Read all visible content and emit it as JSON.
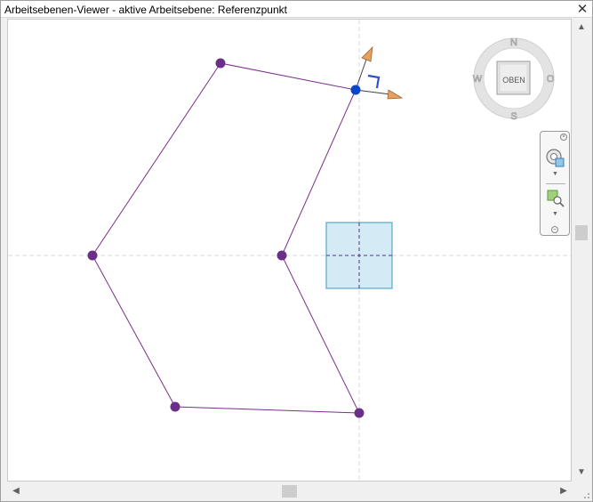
{
  "window": {
    "title": "Arbeitsebenen-Viewer - aktive Arbeitsebene: Referenzpunkt"
  },
  "viewcube": {
    "face_label": "OBEN",
    "compass": {
      "north": "N",
      "south": "S",
      "east": "O",
      "west": "W"
    }
  },
  "icons": {
    "close": "close-icon",
    "steering_wheel": "steering-wheel-icon",
    "zoom": "zoom-icon",
    "scroll_up": "chevron-up-icon",
    "scroll_down": "chevron-down-icon",
    "scroll_left": "chevron-left-icon",
    "scroll_right": "chevron-right-icon"
  },
  "colors": {
    "sketch_line": "#7a2f8a",
    "vertex": "#6b2f8a",
    "active_point": "#0a46c8",
    "ref_plane": "#d9d9d9",
    "plane_fill": "#d4ebf6",
    "plane_stroke": "#3a9ac0",
    "arrow_orange": "#e8a060",
    "glyph_blue": "#3050c0"
  }
}
